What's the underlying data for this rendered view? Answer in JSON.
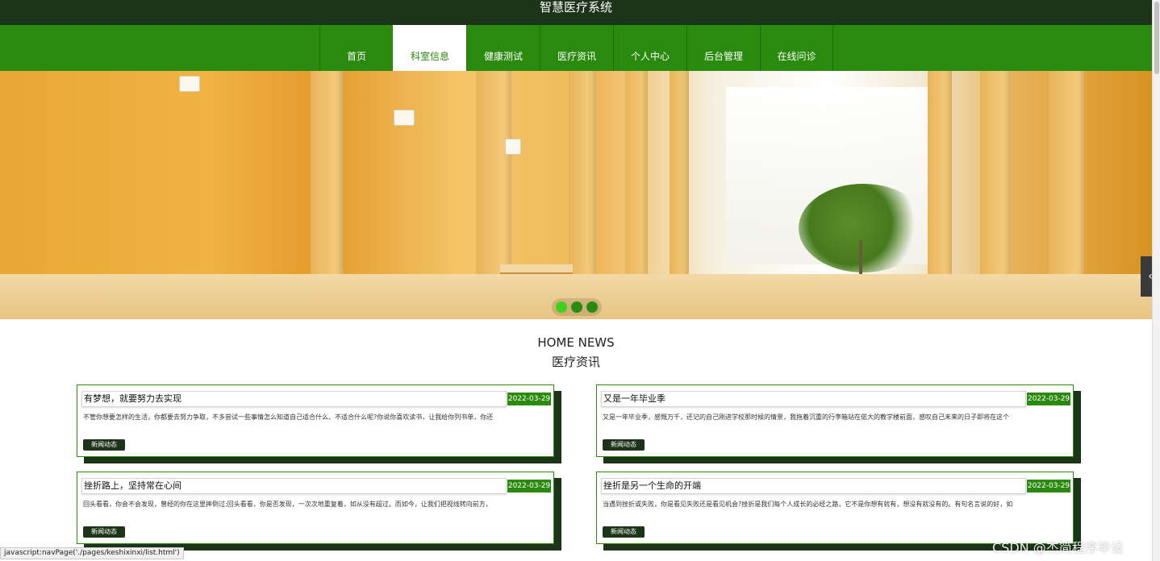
{
  "header": {
    "title": "智慧医疗系统"
  },
  "nav": {
    "items": [
      {
        "label": "首页"
      },
      {
        "label": "科室信息"
      },
      {
        "label": "健康测试"
      },
      {
        "label": "医疗资讯"
      },
      {
        "label": "个人中心"
      },
      {
        "label": "后台管理"
      },
      {
        "label": "在线问诊"
      }
    ],
    "active_index": 1
  },
  "banner": {
    "slide_count": 3,
    "active_slide": 0,
    "side_arrow_icon": "chevron-left-icon"
  },
  "section": {
    "title_en": "HOME NEWS",
    "title_cn": "医疗资讯"
  },
  "news": [
    {
      "title": "有梦想，就要努力去实现",
      "date": "2022-03-29",
      "excerpt": "不管你想要怎样的生活，你都要去努力争取，不多尝试一些事情怎么知道自己适合什么、不适合什么呢?你说你喜欢读书，让我给你列书单，你还",
      "tag": "新闻动态"
    },
    {
      "title": "又是一年毕业季",
      "date": "2022-03-29",
      "excerpt": "又是一年毕业季，感慨万千，还记的自己刚进学校那时候的情景，我拖着沉重的行李箱站在偌大的教学楼前面，感叹自己未来的日子即将在这个",
      "tag": "新闻动态"
    },
    {
      "title": "挫折路上，坚持常在心间",
      "date": "2022-03-29",
      "excerpt": "回头看看，你会不会发现，曾经的你在这里摔倒过;回头看看，你是否发现，一次次地重复着，如从没有超过。而如今，让我们把视线转向前方，",
      "tag": "新闻动态"
    },
    {
      "title": "挫折是另一个生命的开端",
      "date": "2022-03-29",
      "excerpt": "当遇到挫折或失败，你是看见失败还是看见机会?挫折是我们每个人成长的必经之路，它不是你想有就有，想没有就没有的。有句名言说的好，如",
      "tag": "新闻动态"
    }
  ],
  "statusbar": {
    "url": "javascript:navPage('./pages/keshixinxi/list.html')"
  },
  "watermark": "CSDN @杰简程序毕设",
  "colors": {
    "topbar": "#1c3519",
    "nav": "#2a8a0e",
    "accent": "#3fd11a"
  }
}
